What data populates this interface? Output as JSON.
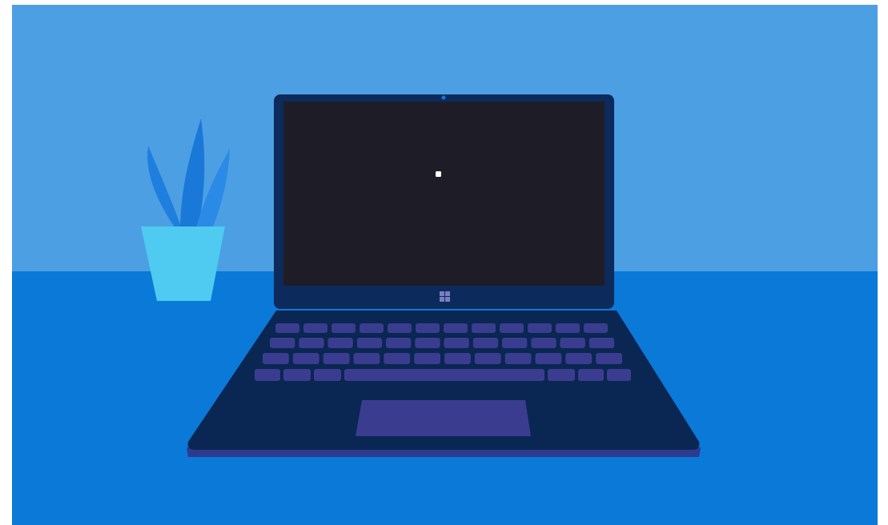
{
  "scene": {
    "description_name": "laptop-illustration",
    "colors": {
      "wall": "#4c9fe3",
      "desk": "#0a79d8",
      "plant_leaf_back": "#1f7fdf",
      "plant_leaf_front": "#2b8ae6",
      "pot": "#4fcaf0",
      "laptop_frame": "#0c2a5c",
      "laptop_base": "#0a2652",
      "laptop_edge": "#2c3a8f",
      "screen": "#1e1d27",
      "screen_dot": "#ffffff",
      "camera": "#1a74d6",
      "keys": "#3a3d8f",
      "trackpad": "#3a3d8f",
      "logo": "#7a7fc4"
    },
    "icons": {
      "logo": "windows-logo-icon",
      "camera": "webcam-icon",
      "cursor": "screen-cursor-dot-icon"
    }
  }
}
